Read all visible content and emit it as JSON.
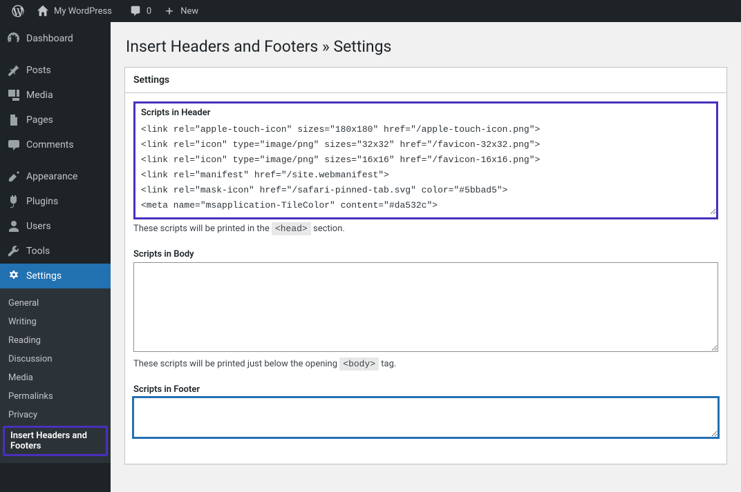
{
  "adminbar": {
    "site_name": "My WordPress",
    "comments_count": "0",
    "new_label": "New"
  },
  "sidebar": {
    "items": [
      {
        "icon": "dashboard",
        "label": "Dashboard"
      },
      {
        "icon": "pin",
        "label": "Posts"
      },
      {
        "icon": "media",
        "label": "Media"
      },
      {
        "icon": "page",
        "label": "Pages"
      },
      {
        "icon": "comment",
        "label": "Comments"
      },
      {
        "icon": "appearance",
        "label": "Appearance"
      },
      {
        "icon": "plugin",
        "label": "Plugins"
      },
      {
        "icon": "user",
        "label": "Users"
      },
      {
        "icon": "tool",
        "label": "Tools"
      },
      {
        "icon": "settings",
        "label": "Settings"
      }
    ],
    "settings_submenu": [
      "General",
      "Writing",
      "Reading",
      "Discussion",
      "Media",
      "Permalinks",
      "Privacy",
      "Insert Headers and Footers"
    ]
  },
  "page": {
    "title": "Insert Headers and Footers » Settings",
    "box_title": "Settings",
    "header": {
      "label": "Scripts in Header",
      "value": "<link rel=\"apple-touch-icon\" sizes=\"180x180\" href=\"/apple-touch-icon.png\">\n<link rel=\"icon\" type=\"image/png\" sizes=\"32x32\" href=\"/favicon-32x32.png\">\n<link rel=\"icon\" type=\"image/png\" sizes=\"16x16\" href=\"/favicon-16x16.png\">\n<link rel=\"manifest\" href=\"/site.webmanifest\">\n<link rel=\"mask-icon\" href=\"/safari-pinned-tab.svg\" color=\"#5bbad5\">\n<meta name=\"msapplication-TileColor\" content=\"#da532c\">\n<meta name=\"theme-color\" content=\"#ffffff\">",
      "hint_pre": "These scripts will be printed in the ",
      "hint_code": "<head>",
      "hint_post": " section."
    },
    "body": {
      "label": "Scripts in Body",
      "value": "",
      "hint_pre": "These scripts will be printed just below the opening ",
      "hint_code": "<body>",
      "hint_post": " tag."
    },
    "footer": {
      "label": "Scripts in Footer",
      "value": ""
    }
  }
}
